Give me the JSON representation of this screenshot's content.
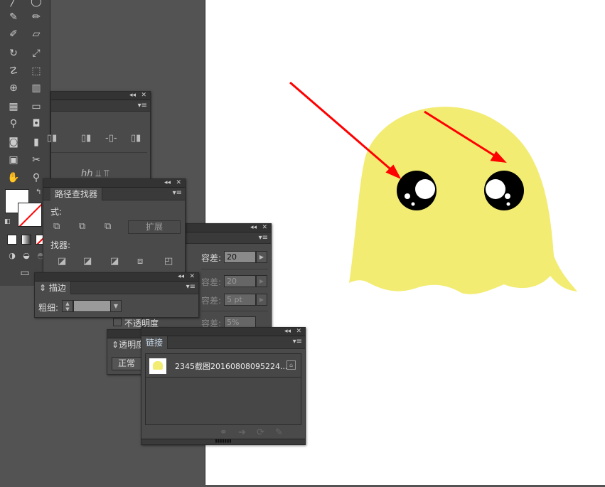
{
  "pathfinder": {
    "title": "路径查找器",
    "shape_modes_label": "式:",
    "expand_button": "扩展",
    "pathfinders_label": "找器:"
  },
  "magic_wand": {
    "rows": [
      {
        "label": "容差:",
        "value": "20",
        "enabled": true
      },
      {
        "label": "容差:",
        "value": "20",
        "enabled": false
      },
      {
        "label": "容差:",
        "value": "5 pt",
        "enabled": false
      },
      {
        "label": "容差:",
        "value": "5%",
        "enabled": false
      }
    ],
    "opacity_checkbox": "不透明度"
  },
  "stroke": {
    "title": "描边",
    "weight_label": "粗细:",
    "weight_value": ""
  },
  "transparency": {
    "title": "透明度",
    "blend_mode": "正常"
  },
  "links": {
    "title": "链接",
    "items": [
      {
        "name": "2345截图20160808095224..."
      }
    ]
  },
  "colors": {
    "ghost": "#f2ec72",
    "arrow": "#ff0000",
    "ui_bg": "#535353"
  }
}
